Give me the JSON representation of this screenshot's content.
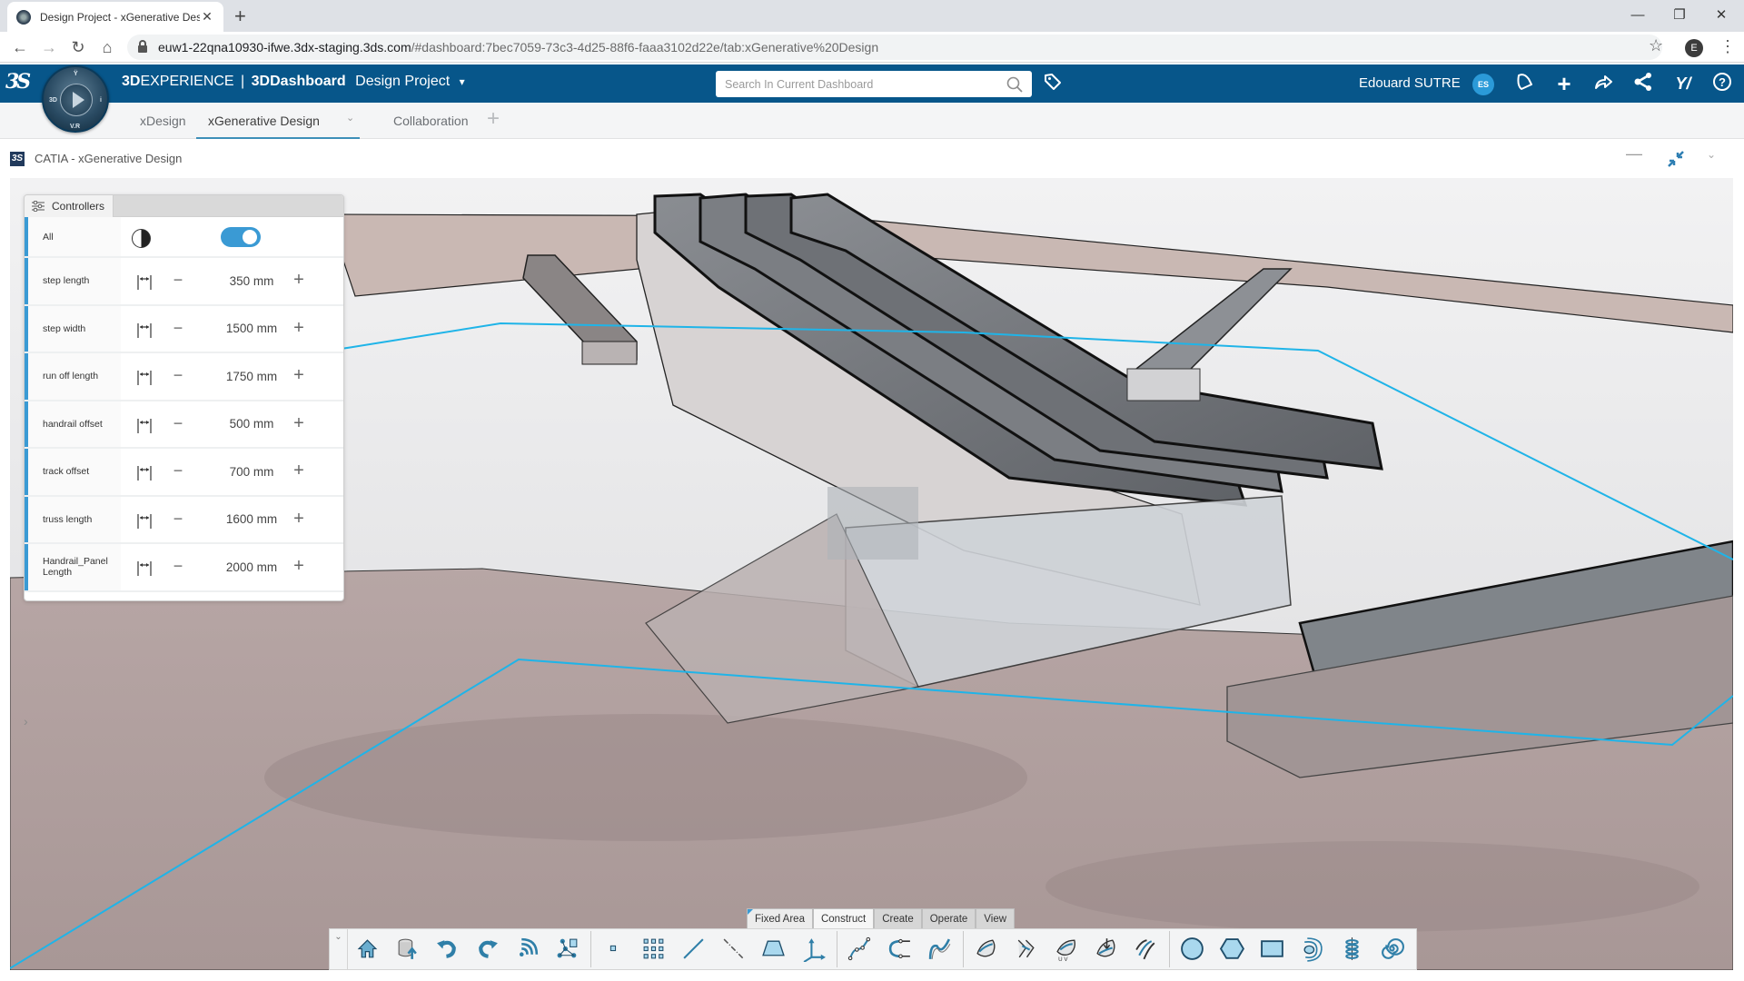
{
  "browser": {
    "tab_title": "Design Project - xGenerative Des",
    "new_tab": "+",
    "url_host": "euw1-22qna10930-ifwe.3dx-staging.3ds.com",
    "url_path": "/#dashboard:7bec7059-73c3-4d25-88f6-faaa3102d22e/tab:xGenerative%20Design",
    "profile_initial": "E",
    "window_controls": {
      "minimize": "—",
      "restore": "❐",
      "close": "✕"
    }
  },
  "header": {
    "brand_strong": "3D",
    "brand_rest": "EXPERIENCE",
    "separator": "|",
    "app": "3DDashboard",
    "project": "Design Project",
    "compass_labels": {
      "top": "Ÿ",
      "left": "3D",
      "right": "i",
      "bottom": "V.R"
    },
    "search_placeholder": "Search In Current Dashboard",
    "user_name": "Edouard SUTRE",
    "user_initials": "ES"
  },
  "tabs": [
    {
      "label": "xDesign",
      "active": false
    },
    {
      "label": "xGenerative Design",
      "active": true
    },
    {
      "label": "Collaboration",
      "active": false
    }
  ],
  "widget": {
    "logo": "3S",
    "title": "CATIA - xGenerative Design"
  },
  "controllers": {
    "tab_label": "Controllers",
    "all_label": "All",
    "all_toggle_on": true,
    "rows": [
      {
        "label": "step length",
        "value": "350 mm"
      },
      {
        "label": "step width",
        "value": "1500 mm"
      },
      {
        "label": "run off length",
        "value": "1750 mm"
      },
      {
        "label": "handrail offset",
        "value": "500 mm"
      },
      {
        "label": "track offset",
        "value": "700 mm"
      },
      {
        "label": "truss length",
        "value": "1600 mm"
      },
      {
        "label": "Handrail_Panel Length",
        "value": "2000 mm"
      }
    ],
    "minus": "−",
    "plus": "+"
  },
  "action_bar": {
    "section_tabs": [
      {
        "label": "Fixed Area",
        "state": "fixed"
      },
      {
        "label": "Construct",
        "state": "active"
      },
      {
        "label": "Create",
        "state": "normal"
      },
      {
        "label": "Operate",
        "state": "normal"
      },
      {
        "label": "View",
        "state": "normal"
      }
    ],
    "groups": [
      [
        "home",
        "save-upload",
        "undo",
        "redo",
        "feed",
        "graph-node"
      ],
      [
        "point",
        "point-grid",
        "line",
        "axis-line",
        "plane",
        "axis-system"
      ],
      [
        "polyline",
        "connect-curve",
        "spline"
      ],
      [
        "sweep-surface",
        "multi-section",
        "uv-surface",
        "project-surface",
        "parallel-curves"
      ],
      [
        "circle",
        "hexagon",
        "rectangle",
        "ellipse-spiral",
        "helix",
        "spiral"
      ]
    ]
  },
  "colors": {
    "header_bg": "#07568a",
    "accent": "#3a9ad4",
    "guide_line": "#1fb4e8"
  }
}
